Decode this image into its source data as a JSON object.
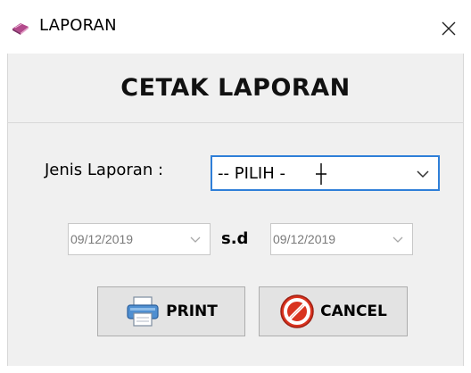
{
  "window": {
    "title": "LAPORAN",
    "close_glyph": "✕"
  },
  "header": {
    "title": "CETAK LAPORAN"
  },
  "form": {
    "jenis_label": "Jenis Laporan :",
    "jenis_value": "-- PILIH -",
    "date_from": "09/12/2019",
    "sd_label": "s.d",
    "date_to": "09/12/2019"
  },
  "buttons": {
    "print_label": "PRINT",
    "cancel_label": "CANCEL"
  },
  "icons": {
    "app": "book-icon",
    "print": "printer-icon",
    "cancel": "cancel-icon",
    "dropdown": "chevron-down-icon"
  },
  "colors": {
    "focus_border": "#2f7fd8",
    "cancel_red": "#d9331f",
    "client_bg": "#f0f0f0"
  }
}
